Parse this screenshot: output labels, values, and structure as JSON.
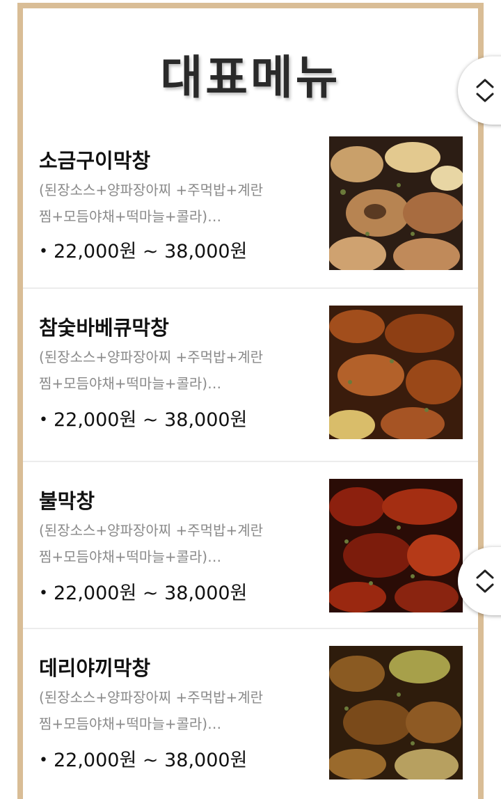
{
  "page": {
    "title": "대표메뉴"
  },
  "menu": {
    "items": [
      {
        "name": "소금구이막창",
        "description": "(된장소스+양파장아찌 +주먹밥+계란\n찜+모듬야채+떡마늘+콜라)…",
        "price": "22,000원 ~ 38,000원",
        "photo_tone": "salted"
      },
      {
        "name": "참숯바베큐막창",
        "description": "(된장소스+양파장아찌 +주먹밥+계란\n찜+모듬야채+떡마늘+콜라)…",
        "price": "22,000원 ~ 38,000원",
        "photo_tone": "barbecue"
      },
      {
        "name": "불막창",
        "description": "(된장소스+양파장아찌 +주먹밥+계란\n찜+모듬야채+떡마늘+콜라)…",
        "price": "22,000원 ~ 38,000원",
        "photo_tone": "spicy"
      },
      {
        "name": "데리야끼막창",
        "description": "(된장소스+양파장아찌 +주먹밥+계란\n찜+모듬야채+떡마늘+콜라)…",
        "price": "22,000원 ~ 38,000원",
        "photo_tone": "teriyaki"
      }
    ]
  },
  "controls": {
    "scroll_buttons": [
      {
        "icon": "chevron-up-down-icon"
      },
      {
        "icon": "chevron-up-down-icon"
      }
    ]
  },
  "colors": {
    "frame_border": "#d9bd96",
    "name_text": "#111111",
    "desc_text": "#8a8a8a",
    "divider": "#ececec"
  }
}
